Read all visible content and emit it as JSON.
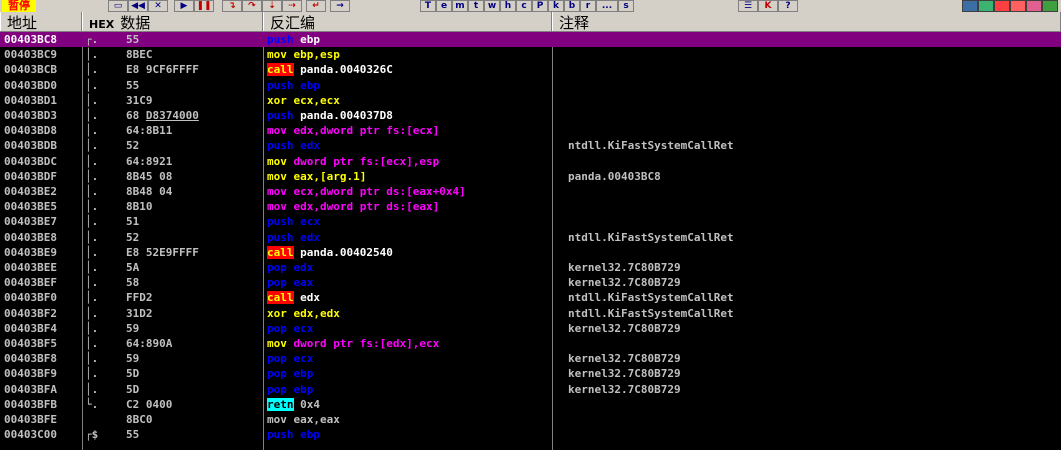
{
  "toolbar": {
    "status": "暂停",
    "buttons": [
      "T",
      "e",
      "m",
      "t",
      "w",
      "h",
      "c",
      "P",
      "k",
      "b",
      "r",
      "...",
      "s"
    ],
    "color": {
      "accent_status": "#ffff00",
      "status_text": "#ff0000"
    }
  },
  "header": {
    "addr": "地址",
    "hex_tag": "HEX",
    "data": "数据",
    "disasm": "反汇编",
    "comment": "注释"
  },
  "rows": [
    {
      "addr": "00403BC8",
      "mark": "┌.",
      "hex": "55",
      "parts": [
        {
          "t": "push",
          "c": "p"
        },
        {
          "t": " ebp",
          "c": "o"
        }
      ],
      "cmt": "",
      "sel": true
    },
    {
      "addr": "00403BC9",
      "mark": "│.",
      "hex": "8BEC",
      "parts": [
        {
          "t": "mov",
          "c": "m"
        },
        {
          "t": " ebp,esp",
          "c": "m"
        }
      ],
      "cmt": ""
    },
    {
      "addr": "00403BCB",
      "mark": "│.",
      "hex": "E8 9CF6FFFF",
      "parts": [
        {
          "t": "call",
          "c": "cl"
        },
        {
          "t": " panda.0040326C",
          "c": "o"
        }
      ],
      "cmt": ""
    },
    {
      "addr": "00403BD0",
      "mark": "│.",
      "hex": "55",
      "parts": [
        {
          "t": "push",
          "c": "p"
        },
        {
          "t": " ebp",
          "c": "p"
        }
      ],
      "cmt": ""
    },
    {
      "addr": "00403BD1",
      "mark": "│.",
      "hex": "31C9",
      "parts": [
        {
          "t": "xor",
          "c": "m"
        },
        {
          "t": " ecx,ecx",
          "c": "m"
        }
      ],
      "cmt": ""
    },
    {
      "addr": "00403BD3",
      "mark": "│.",
      "hex": "68 D8374000",
      "ul": true,
      "parts": [
        {
          "t": "push",
          "c": "p"
        },
        {
          "t": " panda.004037D8",
          "c": "o"
        }
      ],
      "cmt": ""
    },
    {
      "addr": "00403BD8",
      "mark": "│.",
      "hex": "64:8B11",
      "parts": [
        {
          "t": "mov",
          "c": "r"
        },
        {
          "t": " edx,dword ptr fs:[ecx]",
          "c": "r"
        }
      ],
      "cmt": ""
    },
    {
      "addr": "00403BDB",
      "mark": "│.",
      "hex": "52",
      "parts": [
        {
          "t": "push",
          "c": "p"
        },
        {
          "t": " edx",
          "c": "p"
        }
      ],
      "cmt": "ntdll.KiFastSystemCallRet"
    },
    {
      "addr": "00403BDC",
      "mark": "│.",
      "hex": "64:8921",
      "parts": [
        {
          "t": "mov",
          "c": "m"
        },
        {
          "t": " dword ptr fs:[ecx],esp",
          "c": "r"
        }
      ],
      "cmt": ""
    },
    {
      "addr": "00403BDF",
      "mark": "│.",
      "hex": "8B45 08",
      "parts": [
        {
          "t": "mov",
          "c": "m"
        },
        {
          "t": " eax,[arg.1]",
          "c": "m"
        }
      ],
      "cmt": "panda.00403BC8"
    },
    {
      "addr": "00403BE2",
      "mark": "│.",
      "hex": "8B48 04",
      "parts": [
        {
          "t": "mov",
          "c": "r"
        },
        {
          "t": " ecx,dword ptr ds:[eax+0x4]",
          "c": "r"
        }
      ],
      "cmt": ""
    },
    {
      "addr": "00403BE5",
      "mark": "│.",
      "hex": "8B10",
      "parts": [
        {
          "t": "mov",
          "c": "r"
        },
        {
          "t": " edx,dword ptr ds:[eax]",
          "c": "r"
        }
      ],
      "cmt": ""
    },
    {
      "addr": "00403BE7",
      "mark": "│.",
      "hex": "51",
      "parts": [
        {
          "t": "push",
          "c": "p"
        },
        {
          "t": " ecx",
          "c": "p"
        }
      ],
      "cmt": ""
    },
    {
      "addr": "00403BE8",
      "mark": "│.",
      "hex": "52",
      "parts": [
        {
          "t": "push",
          "c": "p"
        },
        {
          "t": " edx",
          "c": "p"
        }
      ],
      "cmt": "ntdll.KiFastSystemCallRet"
    },
    {
      "addr": "00403BE9",
      "mark": "│.",
      "hex": "E8 52E9FFFF",
      "parts": [
        {
          "t": "call",
          "c": "cl"
        },
        {
          "t": " panda.00402540",
          "c": "o"
        }
      ],
      "cmt": ""
    },
    {
      "addr": "00403BEE",
      "mark": "│.",
      "hex": "5A",
      "parts": [
        {
          "t": "pop",
          "c": "p"
        },
        {
          "t": " edx",
          "c": "p"
        }
      ],
      "cmt": "kernel32.7C80B729"
    },
    {
      "addr": "00403BEF",
      "mark": "│.",
      "hex": "58",
      "parts": [
        {
          "t": "pop",
          "c": "p"
        },
        {
          "t": " eax",
          "c": "p"
        }
      ],
      "cmt": "kernel32.7C80B729"
    },
    {
      "addr": "00403BF0",
      "mark": "│.",
      "hex": "FFD2",
      "parts": [
        {
          "t": "call",
          "c": "cl"
        },
        {
          "t": " edx",
          "c": "o"
        }
      ],
      "cmt": "ntdll.KiFastSystemCallRet"
    },
    {
      "addr": "00403BF2",
      "mark": "│.",
      "hex": "31D2",
      "parts": [
        {
          "t": "xor",
          "c": "m"
        },
        {
          "t": " edx,edx",
          "c": "m"
        }
      ],
      "cmt": "ntdll.KiFastSystemCallRet"
    },
    {
      "addr": "00403BF4",
      "mark": "│.",
      "hex": "59",
      "parts": [
        {
          "t": "pop",
          "c": "p"
        },
        {
          "t": " ecx",
          "c": "p"
        }
      ],
      "cmt": "kernel32.7C80B729"
    },
    {
      "addr": "00403BF5",
      "mark": "│.",
      "hex": "64:890A",
      "parts": [
        {
          "t": "mov",
          "c": "m"
        },
        {
          "t": " dword ptr fs:[edx],ecx",
          "c": "r"
        }
      ],
      "cmt": ""
    },
    {
      "addr": "00403BF8",
      "mark": "│.",
      "hex": "59",
      "parts": [
        {
          "t": "pop",
          "c": "p"
        },
        {
          "t": " ecx",
          "c": "p"
        }
      ],
      "cmt": "kernel32.7C80B729"
    },
    {
      "addr": "00403BF9",
      "mark": "│.",
      "hex": "5D",
      "parts": [
        {
          "t": "pop",
          "c": "p"
        },
        {
          "t": " ebp",
          "c": "p"
        }
      ],
      "cmt": "kernel32.7C80B729"
    },
    {
      "addr": "00403BFA",
      "mark": "│.",
      "hex": "5D",
      "parts": [
        {
          "t": "pop",
          "c": "p"
        },
        {
          "t": " ebp",
          "c": "p"
        }
      ],
      "cmt": "kernel32.7C80B729"
    },
    {
      "addr": "00403BFB",
      "mark": "└.",
      "hex": "C2 0400",
      "parts": [
        {
          "t": "retn",
          "c": "rt"
        },
        {
          "t": " 0x4",
          "c": "dimg"
        }
      ],
      "cmt": ""
    },
    {
      "addr": "00403BFE",
      "mark": "",
      "hex": "8BC0",
      "parts": [
        {
          "t": "mov eax,eax",
          "c": "dim"
        }
      ],
      "cmt": ""
    },
    {
      "addr": "00403C00",
      "mark": "┌$",
      "hex": "55",
      "parts": [
        {
          "t": "push",
          "c": "p"
        },
        {
          "t": " ebp",
          "c": "p"
        }
      ],
      "cmt": ""
    }
  ]
}
